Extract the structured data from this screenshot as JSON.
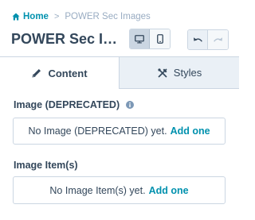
{
  "breadcrumb": {
    "home_label": "Home",
    "separator": ">",
    "current_label": "POWER Sec Images"
  },
  "header": {
    "title": "POWER Sec Images"
  },
  "device_toggle": {
    "options": [
      "desktop-icon",
      "mobile-icon"
    ],
    "selected": "desktop"
  },
  "history": {
    "undo_icon": "undo-icon",
    "redo_icon": "redo-icon",
    "redo_enabled": false
  },
  "tabs": [
    {
      "label": "Content",
      "icon": "pencil-icon",
      "active": true
    },
    {
      "label": "Styles",
      "icon": "styles-icon",
      "active": false
    }
  ],
  "fields": [
    {
      "label": "Image (DEPRECATED)",
      "has_info_icon": true,
      "empty_text": "No Image (DEPRECATED) yet.",
      "add_link": "Add one"
    },
    {
      "label": "Image Item(s)",
      "has_info_icon": false,
      "empty_text": "No Image Item(s) yet.",
      "add_link": "Add one"
    }
  ],
  "colors": {
    "link": "#0091ae",
    "text": "#33475b",
    "border": "#cbd6e2",
    "muted": "#99acc2",
    "tab_inactive_bg": "#eaf0f6"
  }
}
